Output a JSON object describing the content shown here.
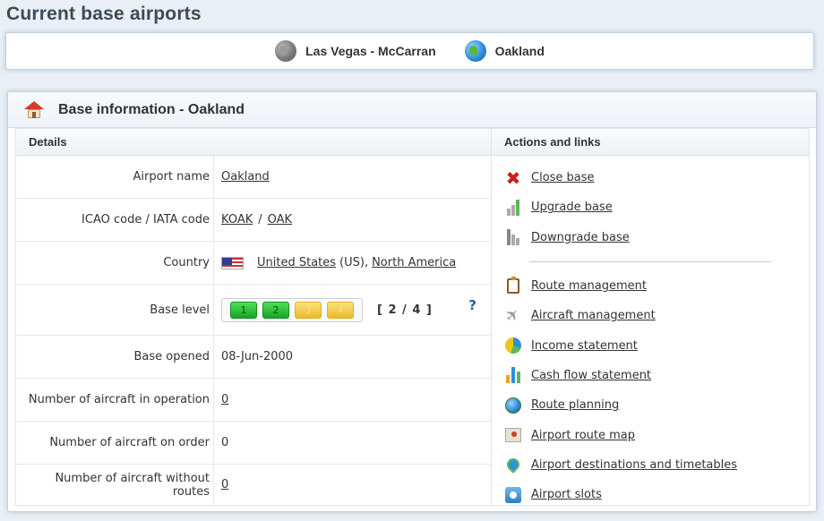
{
  "page_title": "Current base airports",
  "bases": [
    {
      "label": "Las Vegas - McCarran",
      "icon": "globe-grey-icon"
    },
    {
      "label": "Oakland",
      "icon": "globe-color-icon"
    }
  ],
  "panel": {
    "title": "Base information - Oakland",
    "details_header": "Details",
    "actions_header": "Actions and links"
  },
  "details": {
    "airport_name_label": "Airport name",
    "airport_name_value": "Oakland",
    "codes_label": "ICAO code / IATA code",
    "icao": "KOAK",
    "code_sep": "/",
    "iata": "OAK",
    "country_label": "Country",
    "country_name": "United States",
    "country_code": "(US),",
    "continent": "North America",
    "base_level_label": "Base level",
    "levels": [
      "1",
      "2",
      "3",
      "4"
    ],
    "level_current": 2,
    "level_text": "[ 2 / 4 ]",
    "help": "?",
    "base_opened_label": "Base opened",
    "base_opened_value": "08-Jun-2000",
    "aircraft_in_operation_label": "Number of aircraft in operation",
    "aircraft_in_operation_value": "0",
    "aircraft_on_order_label": "Number of aircraft on order",
    "aircraft_on_order_value": "0",
    "aircraft_without_routes_label": "Number of aircraft without routes",
    "aircraft_without_routes_value": "0"
  },
  "actions": {
    "close_base": "Close base",
    "upgrade_base": "Upgrade base",
    "downgrade_base": "Downgrade base",
    "route_management": "Route management",
    "aircraft_management": "Aircraft management",
    "income_statement": "Income statement",
    "cash_flow_statement": "Cash flow statement",
    "route_planning": "Route planning",
    "airport_route_map": "Airport route map",
    "airport_destinations": "Airport destinations and timetables",
    "airport_slots": "Airport slots"
  }
}
